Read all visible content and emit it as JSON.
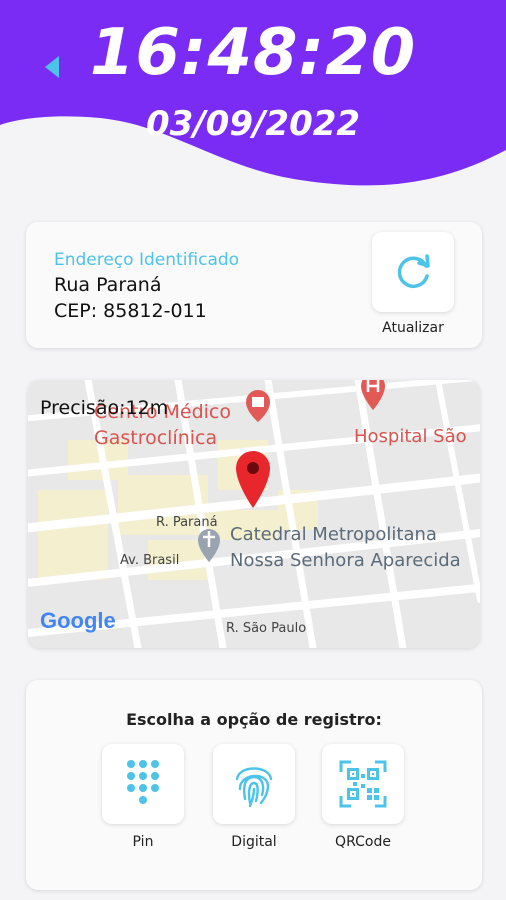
{
  "colors": {
    "header_purple": "#7a2cf5",
    "accent_cyan": "#4cc3e8"
  },
  "header": {
    "time": "16:48:20",
    "date": "03/09/2022",
    "back_icon": "back-triangle-icon"
  },
  "address": {
    "label": "Endereço Identificado",
    "street": "Rua Paraná",
    "cep": "CEP: 85812-011",
    "refresh_label": "Atualizar",
    "refresh_icon": "refresh-icon"
  },
  "map": {
    "precision": "Precisão:12m",
    "poi_medical_1": "Centro Médico",
    "poi_medical_2": "Gastroclínica",
    "poi_hospital": "Hospital São",
    "street_parana": "R. Paraná",
    "street_brasil": "Av. Brasil",
    "street_sao_paulo": "R. São Paulo",
    "cathedral_1": "Catedral Metropolitana",
    "cathedral_2": "Nossa Senhora Aparecida",
    "attribution": "Google"
  },
  "registration": {
    "title": "Escolha a opção de registro:",
    "options": [
      {
        "label": "Pin",
        "icon": "keypad-icon"
      },
      {
        "label": "Digital",
        "icon": "fingerprint-icon"
      },
      {
        "label": "QRCode",
        "icon": "qrcode-icon"
      }
    ]
  }
}
